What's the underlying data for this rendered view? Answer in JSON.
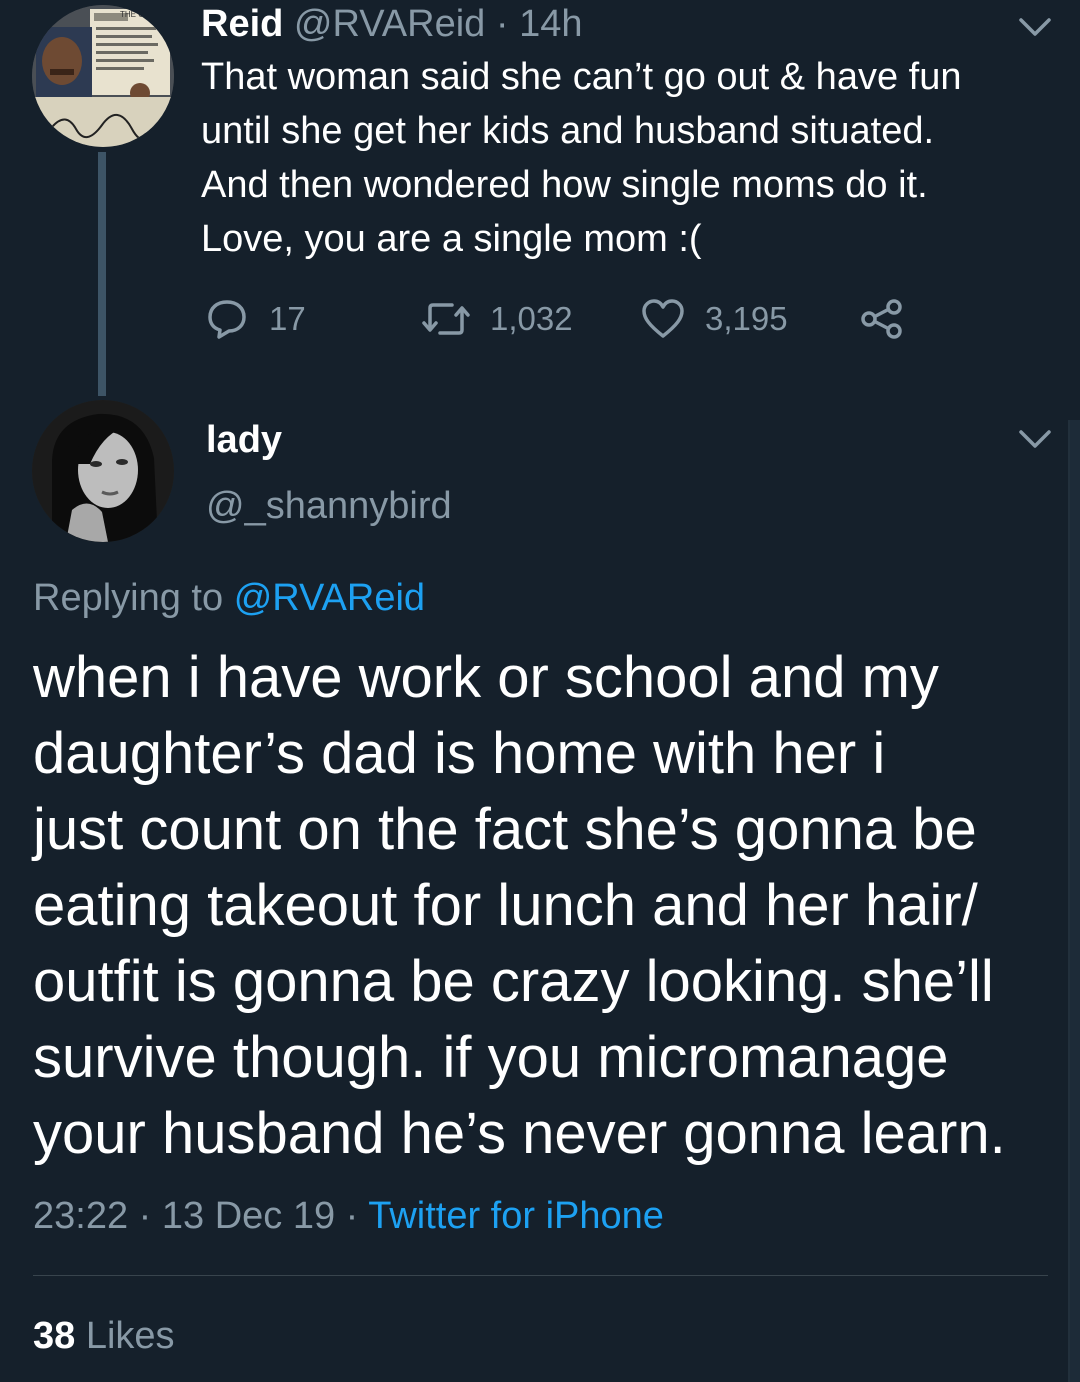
{
  "parent_tweet": {
    "name": "Reid",
    "handle": "@RVAReid",
    "separator": "·",
    "time": "14h",
    "lines": [
      "That woman said she can’t go out & have fun",
      "until she get her kids and husband situated.",
      "And then wondered how single moms do it.",
      "Love, you are a single mom :("
    ],
    "replies": "17",
    "retweets": "1,032",
    "likes": "3,195",
    "avatar_text": "THE CIT"
  },
  "main_tweet": {
    "name": "lady",
    "handle": "@_shannybird",
    "replying_prefix": "Replying to",
    "replying_handle": "@RVAReid",
    "lines": [
      "when i have work or school and my",
      "daughter’s dad is home with her i",
      "just count on the fact she’s gonna be",
      "eating takeout for lunch and her hair/",
      "outfit is gonna be crazy looking. she’ll",
      "survive though. if you micromanage",
      "your husband he’s never gonna learn."
    ],
    "time": "23:22",
    "separator": "·",
    "date": "13 Dec 19",
    "source": "Twitter for iPhone",
    "likes_count": "38",
    "likes_label": "Likes"
  },
  "colors": {
    "background": "#15202b",
    "secondary_text": "#8899a6",
    "link": "#1da1f2",
    "thread_line": "#3d5466"
  }
}
